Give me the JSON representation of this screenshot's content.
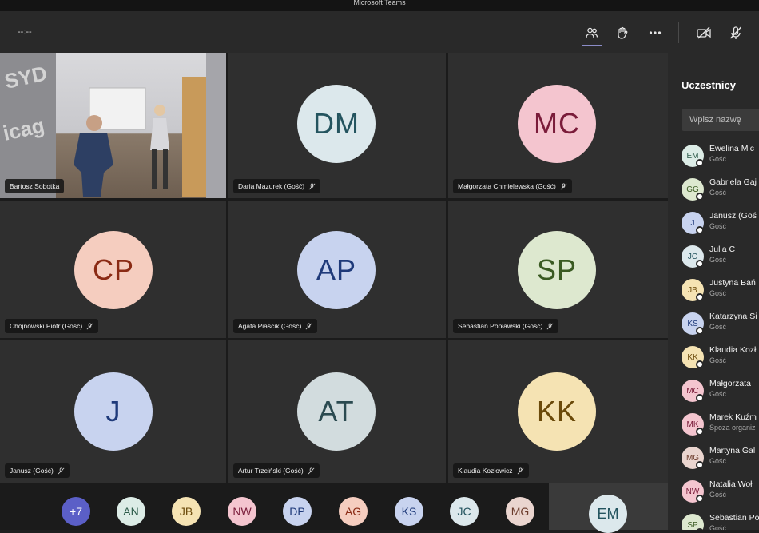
{
  "window": {
    "title": "Microsoft Teams"
  },
  "toolbar": {
    "timer": "--:--",
    "icons": [
      "participants-icon",
      "raise-hand-icon",
      "more-options-icon",
      "camera-off-icon",
      "mic-off-icon"
    ]
  },
  "tiles": [
    {
      "name": "Bartosz Sobotka",
      "initials": "",
      "video": true
    },
    {
      "name": "Daria Mazurek (Gość)",
      "initials": "DM",
      "bg": "#dce8ec",
      "fg": "#24545f"
    },
    {
      "name": "Małgorzata Chmielewska (Gość)",
      "initials": "MC",
      "bg": "#f4c5cf",
      "fg": "#7a1c3a"
    },
    {
      "name": "Chojnowski Piotr (Gość)",
      "initials": "CP",
      "bg": "#f5cdbf",
      "fg": "#8a2a14"
    },
    {
      "name": "Agata Piaścik (Gość)",
      "initials": "AP",
      "bg": "#c8d3ef",
      "fg": "#1f3a7a"
    },
    {
      "name": "Sebastian Popławski (Gość)",
      "initials": "SP",
      "bg": "#dde8cf",
      "fg": "#3a5a22"
    },
    {
      "name": "Janusz (Gość)",
      "initials": "J",
      "bg": "#c8d3ef",
      "fg": "#1f3a7a"
    },
    {
      "name": "Artur Trzciński (Gość)",
      "initials": "AT",
      "bg": "#d2dcde",
      "fg": "#2b4a50"
    },
    {
      "name": "Klaudia Kozłowicz",
      "initials": "KK",
      "bg": "#f5e3b3",
      "fg": "#6b4a0a"
    }
  ],
  "strip": [
    {
      "initials": "+7",
      "bg": "#5b5fc7",
      "fg": "#ffffff"
    },
    {
      "initials": "AN",
      "bg": "#dcece6",
      "fg": "#2b5a48"
    },
    {
      "initials": "JB",
      "bg": "#f5e3b3",
      "fg": "#6b4a0a"
    },
    {
      "initials": "NW",
      "bg": "#f4c5cf",
      "fg": "#7a1c3a"
    },
    {
      "initials": "DP",
      "bg": "#c8d3ef",
      "fg": "#1f3a7a"
    },
    {
      "initials": "AG",
      "bg": "#f5cdbf",
      "fg": "#8a2a14"
    },
    {
      "initials": "KS",
      "bg": "#c8d3ef",
      "fg": "#1f3a7a"
    },
    {
      "initials": "JC",
      "bg": "#dce8ec",
      "fg": "#24545f"
    },
    {
      "initials": "MG",
      "bg": "#ead5cf",
      "fg": "#6a3a2a"
    },
    {
      "initials": "EM",
      "bg": "#dce8ec",
      "fg": "#24545f"
    }
  ],
  "panel": {
    "title": "Uczestnicy",
    "search_placeholder": "Wpisz nazwę",
    "participants": [
      {
        "initials": "EM",
        "name": "Ewelina Mic",
        "role": "Gość",
        "bg": "#dcece6",
        "fg": "#2b5a48"
      },
      {
        "initials": "GG",
        "name": "Gabriela Gaj",
        "role": "Gość",
        "bg": "#dde8cf",
        "fg": "#3a5a22"
      },
      {
        "initials": "J",
        "name": "Janusz (Goś",
        "role": "Gość",
        "bg": "#c8d3ef",
        "fg": "#1f3a7a"
      },
      {
        "initials": "JC",
        "name": "Julia C",
        "role": "Gość",
        "bg": "#dce8ec",
        "fg": "#24545f"
      },
      {
        "initials": "JB",
        "name": "Justyna Bań",
        "role": "Gość",
        "bg": "#f5e3b3",
        "fg": "#6b4a0a"
      },
      {
        "initials": "KS",
        "name": "Katarzyna Si",
        "role": "Gość",
        "bg": "#c8d3ef",
        "fg": "#1f3a7a"
      },
      {
        "initials": "KK",
        "name": "Klaudia Kozł",
        "role": "Gość",
        "bg": "#f5e3b3",
        "fg": "#6b4a0a"
      },
      {
        "initials": "MC",
        "name": "Małgorzata",
        "role": "Gość",
        "bg": "#f4c5cf",
        "fg": "#7a1c3a"
      },
      {
        "initials": "MK",
        "name": "Marek Kuźm",
        "role": "Spoza organiz",
        "bg": "#f4c5cf",
        "fg": "#7a1c3a"
      },
      {
        "initials": "MG",
        "name": "Martyna Gal",
        "role": "Gość",
        "bg": "#ead5cf",
        "fg": "#6a3a2a"
      },
      {
        "initials": "NW",
        "name": "Natalia Woł",
        "role": "Gość",
        "bg": "#f4c5cf",
        "fg": "#7a1c3a"
      },
      {
        "initials": "SP",
        "name": "Sebastian Po",
        "role": "Gość",
        "bg": "#dde8cf",
        "fg": "#3a5a22"
      }
    ]
  }
}
